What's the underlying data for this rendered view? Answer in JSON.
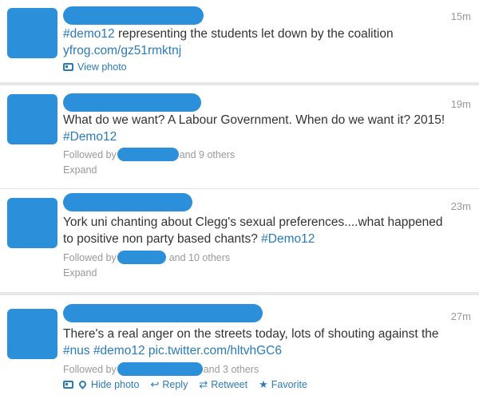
{
  "tweets": [
    {
      "time": "15m",
      "text_parts": {
        "hashtag": "#demo12",
        "body": " representing the students let down by the coalition",
        "link": "yfrog.com/gz51rmktnj"
      },
      "view_photo": "View photo"
    },
    {
      "time": "19m",
      "text_line1": "What do we want? A Labour Government. When do we want it? 2015!",
      "hashtag": "#Demo12",
      "followed_by": "Followed by",
      "others": "and 9 others",
      "expand": "Expand"
    },
    {
      "time": "23m",
      "text_line1": "York uni chanting about Clegg's sexual preferences....what happened",
      "text_line2": "to positive non party based chants? ",
      "hashtag": "#Demo12",
      "followed_by": "Followed by",
      "others": "and 10 others",
      "expand": "Expand"
    },
    {
      "time": "27m",
      "text_line1": "There's a real anger on the streets today, lots of shouting against the",
      "hashtag1": "#nus",
      "hashtag2": "#demo12",
      "link": "pic.twitter.com/hltvhGC6",
      "followed_by": "Followed by",
      "others": "and 3 others",
      "actions": {
        "hide_photo": "Hide photo",
        "reply": "Reply",
        "retweet": "Retweet",
        "favorite": "Favorite"
      }
    }
  ]
}
